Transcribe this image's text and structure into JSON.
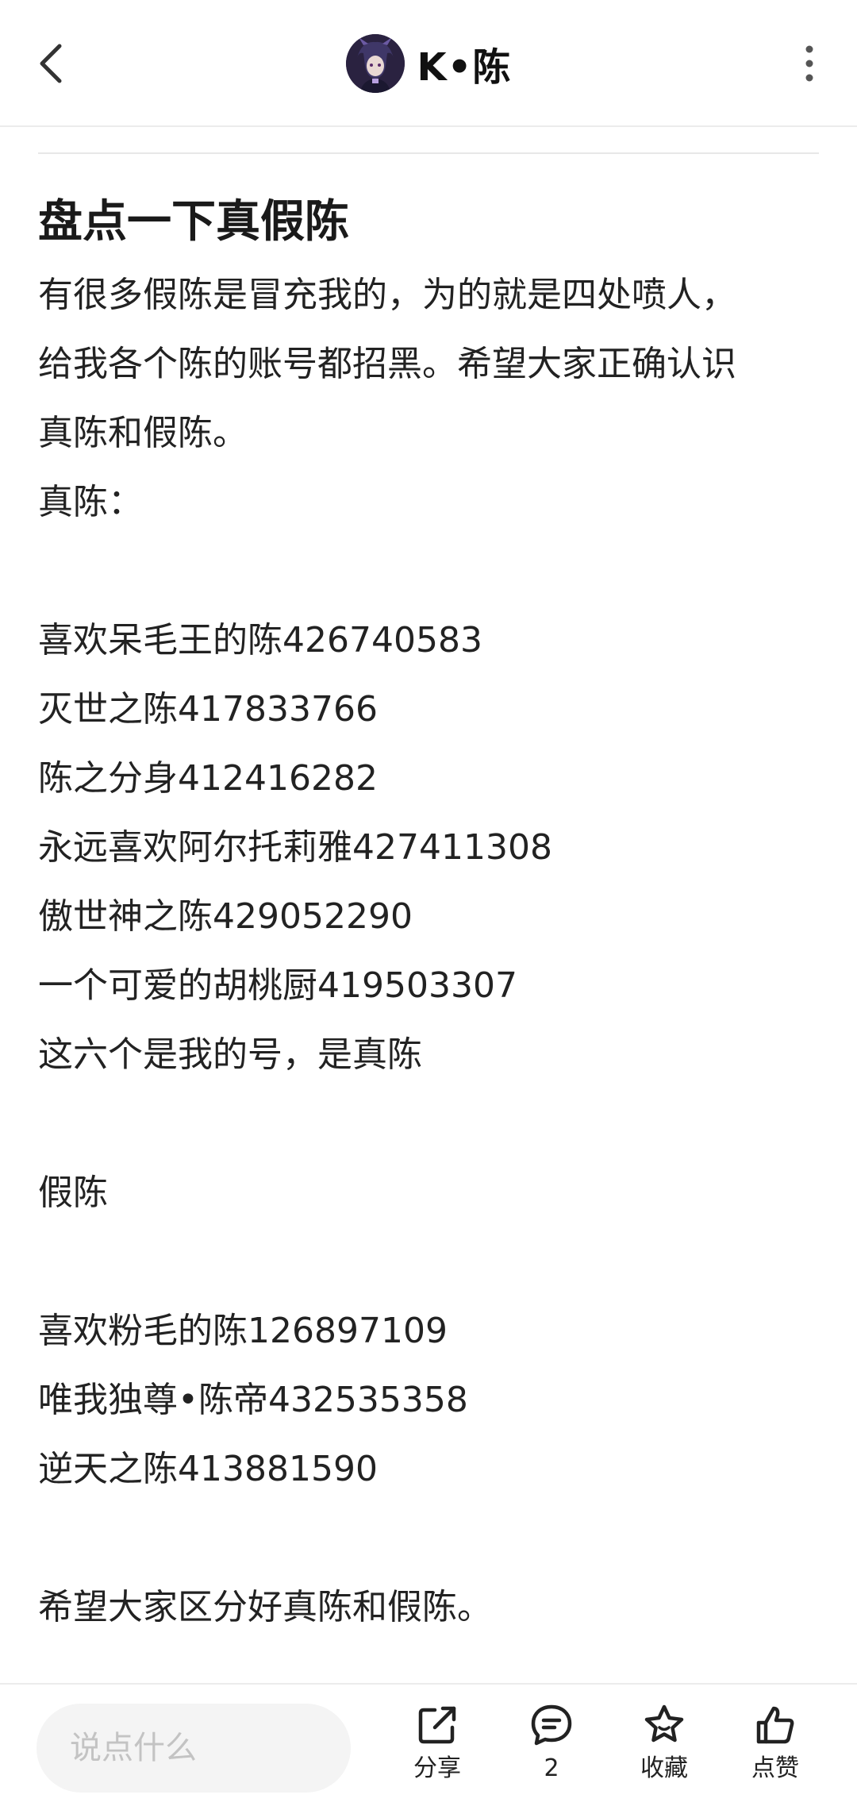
{
  "header": {
    "username": "K•陈",
    "back_icon": "chevron-left-icon",
    "more_icon": "vertical-dots-icon"
  },
  "post": {
    "title": "盘点一下真假陈",
    "intro_lines": [
      "有很多假陈是冒充我的，为的就是四处喷人，",
      "给我各个陈的账号都招黑。希望大家正确认识",
      "真陈和假陈。"
    ],
    "real_heading": "真陈：",
    "real_accounts": [
      "喜欢呆毛王的陈426740583",
      "灭世之陈417833766",
      "陈之分身412416282",
      "永远喜欢阿尔托莉雅427411308",
      "傲世神之陈429052290",
      "一个可爱的胡桃厨419503307"
    ],
    "real_footer": "这六个是我的号，是真陈",
    "fake_heading": "假陈",
    "fake_accounts": [
      "喜欢粉毛的陈126897109",
      "唯我独尊•陈帝432535358",
      "逆天之陈413881590"
    ],
    "closing": "希望大家区分好真陈和假陈。"
  },
  "bottom_bar": {
    "comment_placeholder": "说点什么",
    "share_label": "分享",
    "comment_count": "2",
    "favorite_label": "收藏",
    "like_label": "点赞"
  }
}
